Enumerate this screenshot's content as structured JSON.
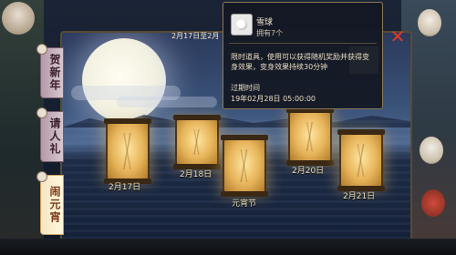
{
  "tabs": [
    {
      "label": "贺新年",
      "active": false
    },
    {
      "label": "请人礼",
      "active": false
    },
    {
      "label": "闹元宵",
      "active": true
    }
  ],
  "header": {
    "date_range": "2月17日至2月"
  },
  "lanterns": [
    {
      "label": "2月17日"
    },
    {
      "label": "2月18日"
    },
    {
      "label": "元宵节"
    },
    {
      "label": "2月20日"
    },
    {
      "label": "2月21日"
    }
  ],
  "popup": {
    "title": "雪球",
    "owned": "拥有7个",
    "description": "限时道具，使用可以获得随机奖励并获得变身效果，变身效果持续30分钟",
    "expiry_label": "过期时间",
    "expiry_value": "19年02月28日 05:00:00",
    "icon": "snowball-icon"
  },
  "close_icon": "close-icon",
  "accent_colors": {
    "tab_active": "#fff6dc",
    "lantern_glow": "#ffe6a0",
    "close": "#e03a2a"
  }
}
